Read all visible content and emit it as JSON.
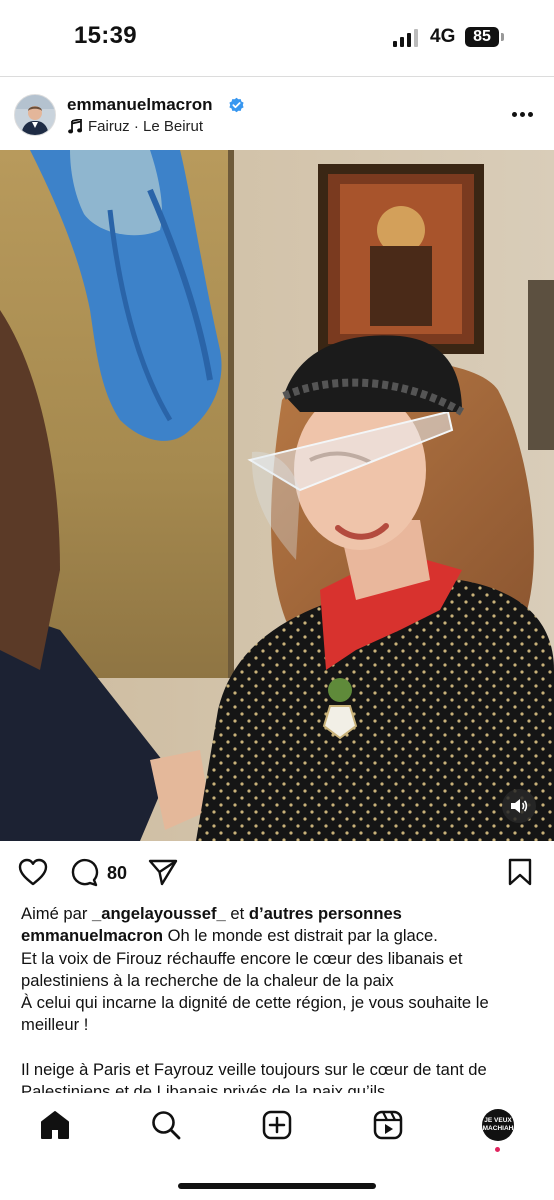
{
  "status_bar": {
    "time": "15:39",
    "network": "4G",
    "battery": "85"
  },
  "post": {
    "username": "emmanuelmacron",
    "verified_icon": "verified-badge-icon",
    "music": "Fairuz · Le Beirut",
    "more_icon": "more-options-icon",
    "sound_icon": "speaker-icon"
  },
  "actions": {
    "like_icon": "heart-icon",
    "comment_icon": "comment-icon",
    "comment_count": "80",
    "share_icon": "paper-plane-icon",
    "save_icon": "bookmark-icon"
  },
  "likes": {
    "prefix": "Aimé par ",
    "user": "_angelayoussef_",
    "middle": " et ",
    "others": "d’autres personnes"
  },
  "caption": {
    "author": "emmanuelmacron",
    "line1": " Oh le monde est distrait par la glace.",
    "line2": "Et la voix de Firouz réchauffe encore le cœur des libanais et palestiniens à la recherche de la chaleur de la paix",
    "line3": "À celui qui incarne la dignité de cette région, je vous souhaite le meilleur !",
    "line4": "Il neige à Paris et Fayrouz veille toujours sur le cœur de tant de Palestiniens et de Libanais privés de la paix qu’ils"
  },
  "nav": {
    "home_icon": "home-icon",
    "search_icon": "search-icon",
    "create_icon": "add-post-icon",
    "reels_icon": "reels-icon",
    "profile_text": "JE VEUX MACHIAH"
  },
  "colors": {
    "verified": "#3897f0",
    "notification_dot": "#e0245e",
    "ribbon": "#d8322e",
    "text": "#111111"
  }
}
